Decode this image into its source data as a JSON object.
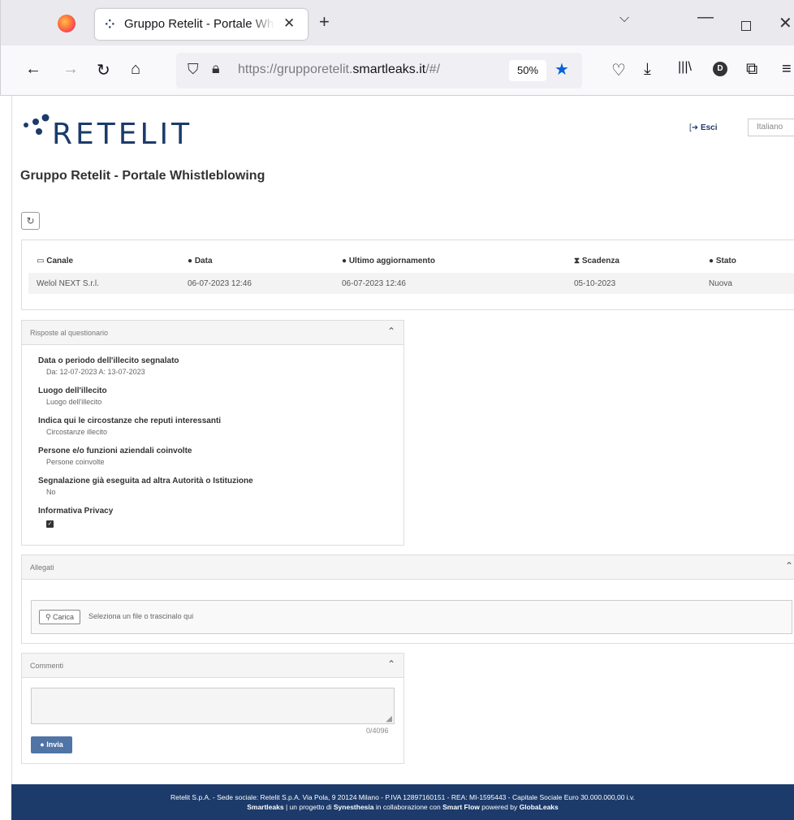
{
  "browser": {
    "tab_title": "Gruppo Retelit - Portale Whistleblowing",
    "url_prefix": "https://grupporetelit.",
    "url_domain": "smartleaks.it",
    "url_suffix": "/#/",
    "zoom": "50%"
  },
  "header": {
    "logout_label": "Esci",
    "language": "Italiano",
    "logo_text": "RETELIT",
    "page_title": "Gruppo Retelit - Portale Whistleblowing"
  },
  "report": {
    "columns": [
      "Canale",
      "Data",
      "Ultimo aggiornamento",
      "Scadenza",
      "Stato"
    ],
    "row": {
      "canale": "Welol NEXT S.r.l.",
      "data": "06-07-2023 12:46",
      "ultimo": "06-07-2023 12:46",
      "scadenza": "05-10-2023",
      "stato": "Nuova"
    }
  },
  "questionnaire": {
    "title": "Risposte al questionario",
    "items": [
      {
        "label": "Data o periodo dell'illecito segnalato",
        "value": "Da: 12-07-2023 A: 13-07-2023"
      },
      {
        "label": "Luogo dell'illecito",
        "value": "Luogo dell'illecito"
      },
      {
        "label": "Indica qui le circostanze che reputi interessanti",
        "value": "Circostanze illecito"
      },
      {
        "label": "Persone e/o funzioni aziendali coinvolte",
        "value": "Persone coinvolte"
      },
      {
        "label": "Segnalazione già eseguita ad altra Autorità o Istituzione",
        "value": "No"
      },
      {
        "label": "Informativa Privacy",
        "value": ""
      }
    ]
  },
  "attachments": {
    "title": "Allegati",
    "upload_label": "Carica",
    "hint": "Seleziona un file o trascinalo qui"
  },
  "comments": {
    "title": "Commenti",
    "counter": "0/4096",
    "send_label": "Invia"
  },
  "footer": {
    "line1": "Retelit S.p.A. - Sede sociale: Retelit S.p.A. Via Pola, 9 20124 Milano - P.IVA 12897160151 - REA: MI-1595443 - Capitale Sociale Euro 30.000.000,00 i.v.",
    "brand1": "Smartleaks",
    "text1": " | un progetto di ",
    "brand2": "Synesthesia",
    "text2": " in collaborazione con ",
    "brand3": "Smart Flow",
    "text3": " powered by ",
    "brand4": "GlobaLeaks"
  }
}
